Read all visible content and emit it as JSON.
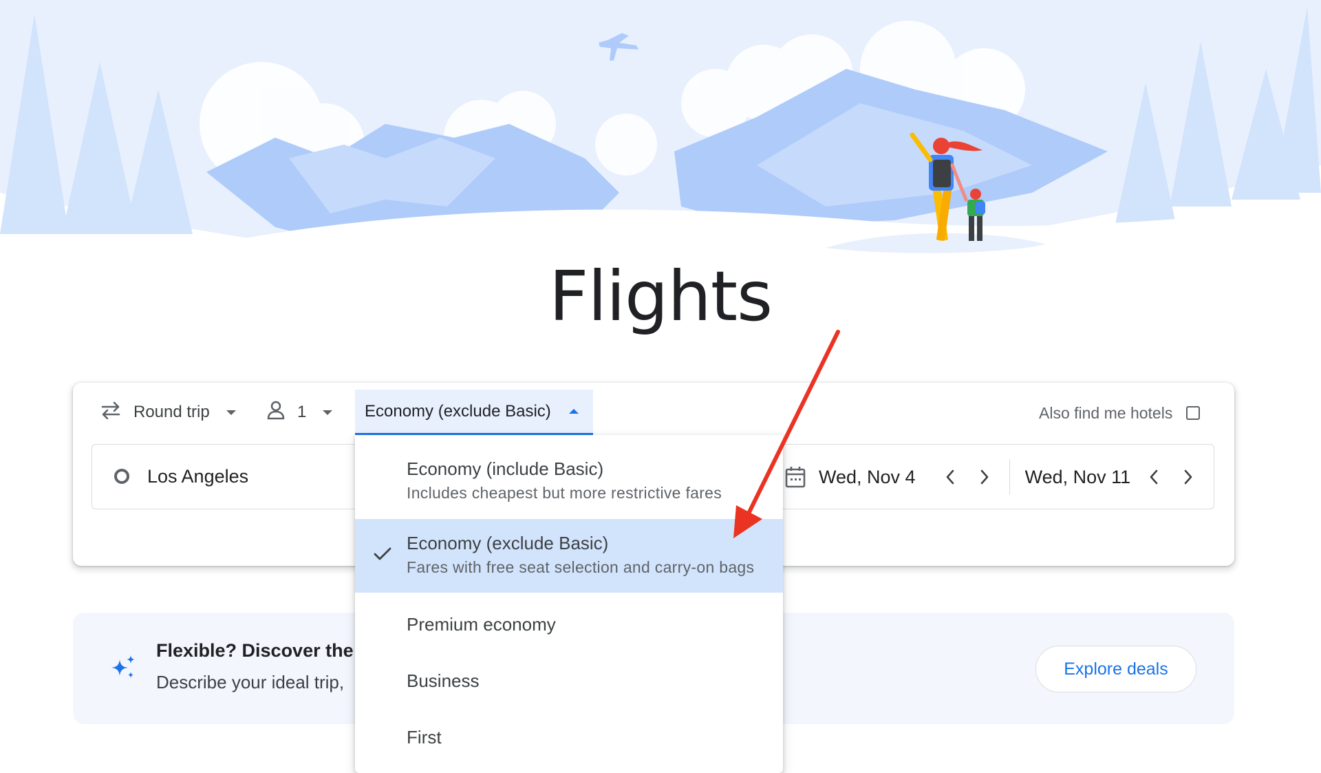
{
  "page": {
    "title": "Flights"
  },
  "search": {
    "trip_type": {
      "label": "Round trip",
      "icon": "swap-arrows-icon"
    },
    "passengers": {
      "count": "1",
      "icon": "person-icon"
    },
    "cabin_class": {
      "label": "Economy (exclude Basic)",
      "open": true
    },
    "also_hotels": {
      "label": "Also find me hotels",
      "checked": false
    },
    "origin": {
      "value": "Los Angeles",
      "icon": "origin-ring-icon"
    },
    "departure": {
      "value": "Wed, Nov 4",
      "icon": "calendar-icon"
    },
    "return": {
      "value": "Wed, Nov 11"
    }
  },
  "cabin_menu": {
    "items": [
      {
        "label": "Economy (include Basic)",
        "description": "Includes cheapest but more restrictive fares",
        "selected": false
      },
      {
        "label": "Economy (exclude Basic)",
        "description": "Fares with free seat selection and carry-on bags",
        "selected": true
      },
      {
        "label": "Premium economy",
        "selected": false
      },
      {
        "label": "Business",
        "selected": false
      },
      {
        "label": "First",
        "selected": false
      }
    ]
  },
  "promo": {
    "title": "Flexible? Discover the",
    "text": "Describe your ideal trip,",
    "button": "Explore deals",
    "icon": "sparkle-icon"
  },
  "colors": {
    "accent": "#1a73e8",
    "selected_bg": "#d2e3fc",
    "hero_sky": "#e8f0fe",
    "hero_mountain": "#aecbfa",
    "annotation_arrow": "#ea3323"
  }
}
